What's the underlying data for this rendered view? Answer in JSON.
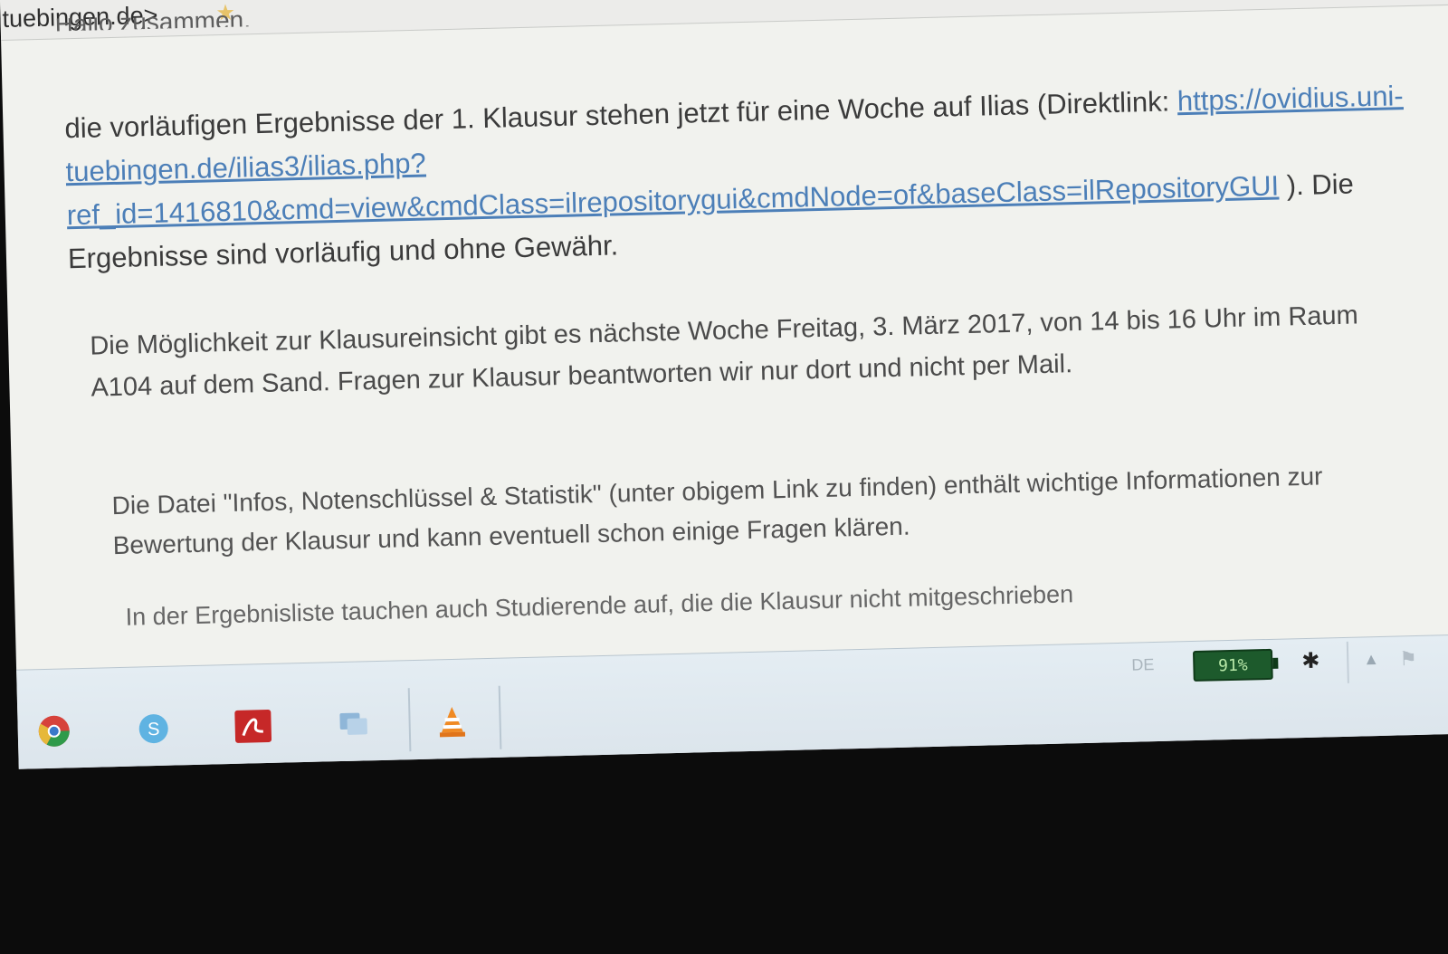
{
  "header": {
    "sender_fragment": "tuebingen.de>",
    "star_icon": "star-icon",
    "greeting_fragment": "Hallo zusammen,"
  },
  "email": {
    "p1_before_link": "die vorläufigen Ergebnisse der 1. Klausur stehen jetzt für eine Woche auf Ilias (Direktlink: ",
    "p1_link": "https://ovidius.uni-tuebingen.de/ilias3/ilias.php?ref_id=1416810&cmd=view&cmdClass=ilrepositorygui&cmdNode=of&baseClass=ilRepositoryGUI",
    "p1_after_link": " ). Die Ergebnisse sind vorläufig und ohne Gewähr.",
    "p2": "Die Möglichkeit zur Klausureinsicht gibt es nächste Woche Freitag, 3. März 2017, von 14 bis 16 Uhr im Raum A104 auf dem Sand. Fragen zur Klausur beantworten wir nur dort und nicht per Mail.",
    "p3": "Die Datei \"Infos, Notenschlüssel & Statistik\" (unter obigem Link zu finden) enthält wichtige Informationen zur Bewertung der Klausur und kann eventuell schon einige Fragen klären.",
    "p4": "In der Ergebnisliste tauchen auch Studierende auf, die die Klausur nicht mitgeschrieben"
  },
  "taskbar": {
    "pinned": [
      "chrome-icon",
      "skype-icon",
      "pdf-reader-icon",
      "network-icon",
      "vlc-icon"
    ],
    "tray": {
      "language": "DE",
      "battery": "91%"
    }
  },
  "colors": {
    "link": "#4c7fb8",
    "battery_bg": "#1d5a2c",
    "taskbar_bg": "#e4edf3"
  }
}
